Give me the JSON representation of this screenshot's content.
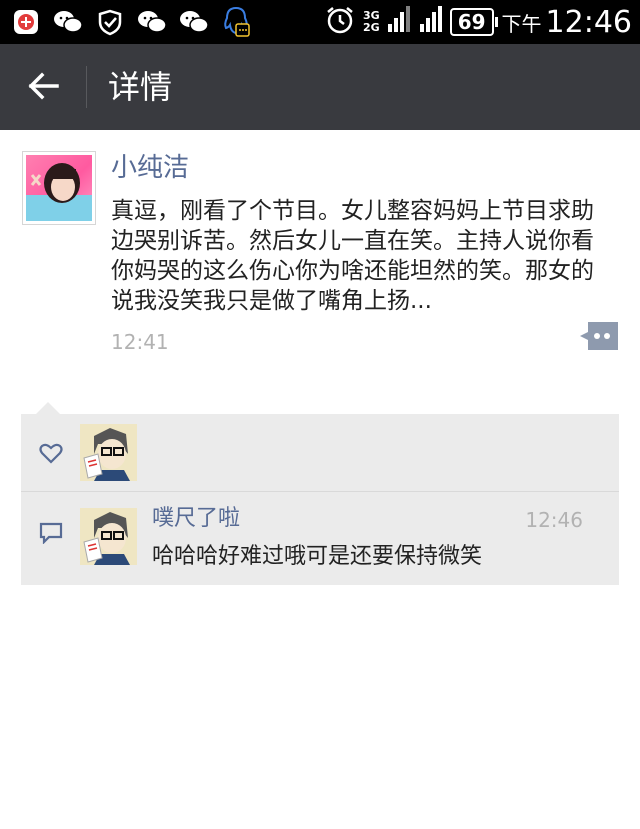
{
  "status_bar": {
    "icons": [
      "add-app-icon",
      "wechat-icon",
      "wechat-sync-icon",
      "wechat-icon",
      "wechat-icon",
      "qq-icon"
    ],
    "network_top": "3G",
    "network_bottom": "2G",
    "battery": "69",
    "ampm": "下午",
    "time": "12:46"
  },
  "header": {
    "title": "详情"
  },
  "post": {
    "username": "小纯洁",
    "text": "真逗，刚看了个节目。女儿整容妈妈上节目求助边哭别诉苦。然后女儿一直在笑。主持人说你看你妈哭的这么伤心你为啥还能坦然的笑。那女的说我没笑我只是做了嘴角上扬...",
    "time": "12:41"
  },
  "comments": [
    {
      "name": "噗尺了啦",
      "time": "12:46",
      "text": "哈哈哈好难过哦可是还要保持微笑"
    }
  ],
  "colors": {
    "header_bg": "#393a3f",
    "link": "#576b95",
    "comment_bg": "#ebebeb"
  }
}
